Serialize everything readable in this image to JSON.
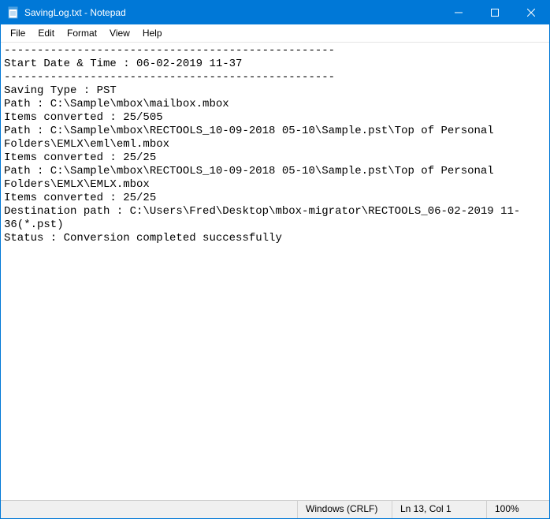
{
  "window": {
    "title": "SavingLog.txt - Notepad"
  },
  "menu": {
    "file": "File",
    "edit": "Edit",
    "format": "Format",
    "view": "View",
    "help": "Help"
  },
  "content": {
    "text": "--------------------------------------------------\nStart Date & Time : 06-02-2019 11-37\n--------------------------------------------------\nSaving Type : PST\nPath : C:\\Sample\\mbox\\mailbox.mbox\nItems converted : 25/505\nPath : C:\\Sample\\mbox\\RECTOOLS_10-09-2018 05-10\\Sample.pst\\Top of Personal Folders\\EMLX\\eml\\eml.mbox\nItems converted : 25/25\nPath : C:\\Sample\\mbox\\RECTOOLS_10-09-2018 05-10\\Sample.pst\\Top of Personal Folders\\EMLX\\EMLX.mbox\nItems converted : 25/25\nDestination path : C:\\Users\\Fred\\Desktop\\mbox-migrator\\RECTOOLS_06-02-2019 11-36(*.pst)\nStatus : Conversion completed successfully"
  },
  "status": {
    "encoding": "Windows (CRLF)",
    "cursor": "Ln 13, Col 1",
    "zoom": "100%"
  }
}
